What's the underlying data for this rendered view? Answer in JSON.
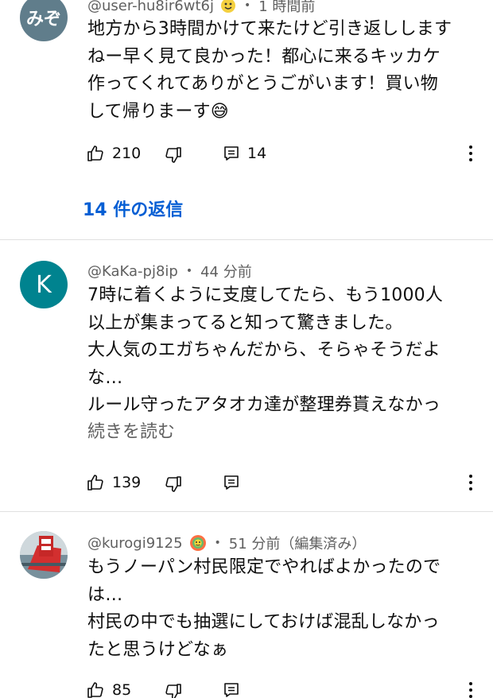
{
  "comments": [
    {
      "avatar_text": "みぞ",
      "avatar_color": "#607d8b",
      "username": "@user-hu8ir6wt6j",
      "time": "1 時間前",
      "lines": [
        "地方から3時間かけて来たけど引き返しします",
        "ねー早く見て良かった！都心に来るキッカケ",
        "作ってくれてありがとうごがいます！買い物",
        "して帰りまーす😅"
      ],
      "likes": "210",
      "reply_count": "14",
      "replies_link": "14 件の返信"
    },
    {
      "avatar_text": "K",
      "avatar_color": "#00838f",
      "username": "@KaKa-pj8ip",
      "time": "44 分前",
      "lines": [
        "7時に着くように支度してたら、もう1000人",
        "以上が集まってると知って驚きました。",
        "大人気のエガちゃんだから、そらゃそうだよ",
        "な…",
        "ルール守ったアタオカ達が整理券貰えなかっ"
      ],
      "read_more": "続きを読む",
      "likes": "139"
    },
    {
      "username": "@kurogi9125",
      "time": "51 分前（編集済み）",
      "lines": [
        "もうノーパン村民限定でやればよかったので",
        "は…",
        "村民の中でも抽選にしておけば混乱しなかっ",
        "たと思うけどなぁ"
      ],
      "likes": "85"
    }
  ],
  "icons": [
    "like-icon",
    "dislike-icon",
    "reply-icon",
    "more-options-icon"
  ],
  "colors": {
    "link": "#065fd4",
    "meta": "#606060",
    "text": "#0f0f0f",
    "divider": "#e0e0e0"
  }
}
